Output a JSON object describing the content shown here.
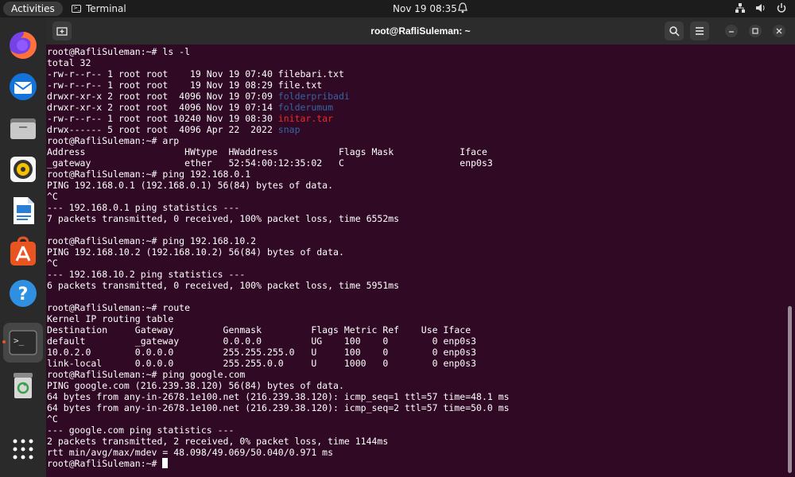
{
  "topbar": {
    "activities": "Activities",
    "app_name": "Terminal",
    "datetime": "Nov 19  08:35"
  },
  "window": {
    "title": "root@RafliSuleman: ~"
  },
  "terminal": {
    "lines": [
      [
        {
          "t": "root@RafliSuleman:~# ls -l"
        }
      ],
      [
        {
          "t": "total 32"
        }
      ],
      [
        {
          "t": "-rw-r--r-- 1 root root    19 Nov 19 07:40 filebari.txt"
        }
      ],
      [
        {
          "t": "-rw-r--r-- 1 root root    19 Nov 19 08:29 file.txt"
        }
      ],
      [
        {
          "t": "drwxr-xr-x 2 root root  4096 Nov 19 07:09 "
        },
        {
          "t": "folderpribadi",
          "c": "blue"
        }
      ],
      [
        {
          "t": "drwxr-xr-x 2 root root  4096 Nov 19 07:14 "
        },
        {
          "t": "folderumum",
          "c": "blue"
        }
      ],
      [
        {
          "t": "-rw-r--r-- 1 root root 10240 Nov 19 08:30 "
        },
        {
          "t": "initar.tar",
          "c": "red"
        }
      ],
      [
        {
          "t": "drwx------ 5 root root  4096 Apr 22  2022 "
        },
        {
          "t": "snap",
          "c": "blue"
        }
      ],
      [
        {
          "t": "root@RafliSuleman:~# arp"
        }
      ],
      [
        {
          "t": "Address                  HWtype  HWaddress           Flags Mask            Iface"
        }
      ],
      [
        {
          "t": "_gateway                 ether   52:54:00:12:35:02   C                     enp0s3"
        }
      ],
      [
        {
          "t": "root@RafliSuleman:~# ping 192.168.0.1"
        }
      ],
      [
        {
          "t": "PING 192.168.0.1 (192.168.0.1) 56(84) bytes of data."
        }
      ],
      [
        {
          "t": "^C"
        }
      ],
      [
        {
          "t": "--- 192.168.0.1 ping statistics ---"
        }
      ],
      [
        {
          "t": "7 packets transmitted, 0 received, 100% packet loss, time 6552ms"
        }
      ],
      [
        {
          "t": ""
        }
      ],
      [
        {
          "t": "root@RafliSuleman:~# ping 192.168.10.2"
        }
      ],
      [
        {
          "t": "PING 192.168.10.2 (192.168.10.2) 56(84) bytes of data."
        }
      ],
      [
        {
          "t": "^C"
        }
      ],
      [
        {
          "t": "--- 192.168.10.2 ping statistics ---"
        }
      ],
      [
        {
          "t": "6 packets transmitted, 0 received, 100% packet loss, time 5951ms"
        }
      ],
      [
        {
          "t": ""
        }
      ],
      [
        {
          "t": "root@RafliSuleman:~# route"
        }
      ],
      [
        {
          "t": "Kernel IP routing table"
        }
      ],
      [
        {
          "t": "Destination     Gateway         Genmask         Flags Metric Ref    Use Iface"
        }
      ],
      [
        {
          "t": "default         _gateway        0.0.0.0         UG    100    0        0 enp0s3"
        }
      ],
      [
        {
          "t": "10.0.2.0        0.0.0.0         255.255.255.0   U     100    0        0 enp0s3"
        }
      ],
      [
        {
          "t": "link-local      0.0.0.0         255.255.0.0     U     1000   0        0 enp0s3"
        }
      ],
      [
        {
          "t": "root@RafliSuleman:~# ping google.com"
        }
      ],
      [
        {
          "t": "PING google.com (216.239.38.120) 56(84) bytes of data."
        }
      ],
      [
        {
          "t": "64 bytes from any-in-2678.1e100.net (216.239.38.120): icmp_seq=1 ttl=57 time=48.1 ms"
        }
      ],
      [
        {
          "t": "64 bytes from any-in-2678.1e100.net (216.239.38.120): icmp_seq=2 ttl=57 time=50.0 ms"
        }
      ],
      [
        {
          "t": "^C"
        }
      ],
      [
        {
          "t": "--- google.com ping statistics ---"
        }
      ],
      [
        {
          "t": "2 packets transmitted, 2 received, 0% packet loss, time 1144ms"
        }
      ],
      [
        {
          "t": "rtt min/avg/max/mdev = 48.098/49.069/50.040/0.971 ms"
        }
      ],
      [
        {
          "t": "root@RafliSuleman:~# "
        }
      ]
    ]
  },
  "dock": {
    "items": [
      {
        "name": "firefox-icon"
      },
      {
        "name": "thunderbird-icon"
      },
      {
        "name": "files-icon"
      },
      {
        "name": "rhythmbox-icon"
      },
      {
        "name": "writer-icon"
      },
      {
        "name": "software-icon"
      },
      {
        "name": "help-icon"
      },
      {
        "name": "terminal-icon"
      },
      {
        "name": "trash-icon"
      },
      {
        "name": "app-grid-icon"
      }
    ]
  },
  "colors": {
    "terminal_bg": "#300a24",
    "dir_blue": "#3465a4",
    "archive_red": "#ef2929",
    "accent": "#e95420"
  }
}
